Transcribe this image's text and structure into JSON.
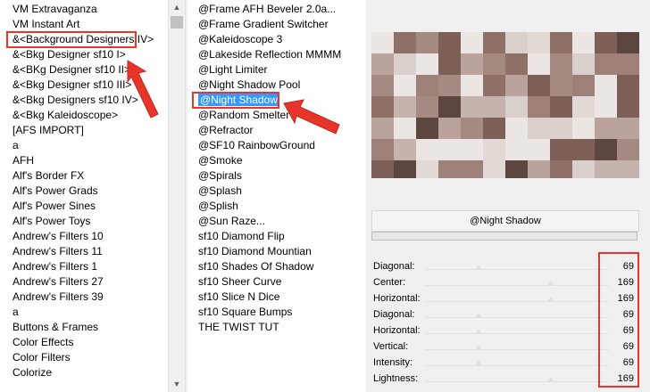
{
  "categories": {
    "items": [
      "VM Extravaganza",
      "VM Instant Art",
      "&<Background Designers IV>",
      "&<Bkg Designer sf10 I>",
      "&<BKg Designer sf10 II>",
      "&<Bkg Designer sf10 III>",
      "&<Bkg Designers sf10 IV>",
      "&<Bkg Kaleidoscope>",
      "[AFS IMPORT]",
      "a",
      "AFH",
      "Alf's Border FX",
      "Alf's Power Grads",
      "Alf's Power Sines",
      "Alf's Power Toys",
      "Andrew's Filters 10",
      "Andrew's Filters 11",
      "Andrew's Filters 1",
      "Andrew's Filters 27",
      "Andrew's Filters 39",
      "a",
      "Buttons & Frames",
      "Color Effects",
      "Color Filters",
      "Colorize"
    ],
    "selected_index": 2
  },
  "filters": {
    "items": [
      "@Frame AFH Beveler 2.0a...",
      "@Frame Gradient Switcher",
      "@Kaleidoscope 3",
      "@Lakeside Reflection MMMM",
      "@Light Limiter",
      "@Night Shadow Pool",
      "@Night Shadow",
      "@Random Smelter",
      "@Refractor",
      "@SF10 RainbowGround",
      "@Smoke",
      "@Spirals",
      "@Splash",
      "@Splish",
      "@Sun Raze...",
      "sf10 Diamond Flip",
      "sf10 Diamond Mountian",
      "sf10 Shades Of Shadow",
      "sf10 Sheer Curve",
      "sf10 Slice N Dice",
      "sf10 Square Bumps",
      "THE TWIST TUT"
    ],
    "selected_index": 6
  },
  "filter_name": "@Night Shadow",
  "params": [
    {
      "label": "Diagonal:",
      "value": "69",
      "level": 69
    },
    {
      "label": "Center:",
      "value": "169",
      "level": 169
    },
    {
      "label": "Horizontal:",
      "value": "169",
      "level": 169
    },
    {
      "label": "Diagonal:",
      "value": "69",
      "level": 69
    },
    {
      "label": "Horizontal:",
      "value": "69",
      "level": 69
    },
    {
      "label": "Vertical:",
      "value": "69",
      "level": 69
    },
    {
      "label": "Intensity:",
      "value": "69",
      "level": 69
    },
    {
      "label": "Lightness:",
      "value": "169",
      "level": 169
    }
  ],
  "colors": {
    "selection": "#3399ff",
    "highlight": "#e8352a"
  }
}
